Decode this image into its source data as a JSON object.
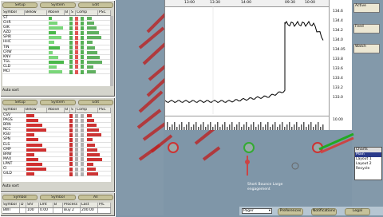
{
  "top_panel": {
    "buttons": [
      "Setup",
      "System",
      "Edit"
    ],
    "columns": [
      "Symbol",
      "Below",
      "Above",
      "B",
      "S",
      "Comp",
      "PSC"
    ],
    "symbols": [
      "ST",
      "CHR",
      "GIK",
      "AZD",
      "SPIR",
      "HHC",
      "TIN",
      "CRW",
      "KNV",
      "TGL",
      "CLD",
      "MCI"
    ],
    "status": "Auto sort"
  },
  "bottom_panel": {
    "buttons": [
      "Setup",
      "System",
      "Edit"
    ],
    "columns": [
      "Symbol",
      "Below",
      "Above",
      "B",
      "S",
      "Comp",
      "PSC"
    ],
    "symbols": [
      "CSV",
      "PAGS",
      "BRN",
      "NCC",
      "KSU",
      "SPN",
      "ELS",
      "CMP",
      "BRW",
      "MAX",
      "LPNT",
      "CI",
      "GILD"
    ],
    "status": "Auto sort"
  },
  "order_panel": {
    "buttons": [
      "Symbol",
      "Symbol",
      "All"
    ],
    "headers": [
      "Symbol",
      "D",
      "Shr",
      "Lmt",
      "B",
      "Process",
      "Last",
      "P/L"
    ],
    "row": [
      "BWT",
      "",
      "100",
      "0.00",
      "",
      "Buy 2",
      "200.00",
      ""
    ]
  },
  "chart": {
    "time_labels": [
      "13:00",
      "13:30",
      "14:00",
      "09:30",
      "10:00"
    ],
    "price_labels": [
      "134.6",
      "134.4",
      "134.2",
      "134.0",
      "134.05",
      "133.8",
      "133.6",
      "133.4",
      "133.2",
      "133.0"
    ],
    "volume_label": "10.00"
  },
  "right_sidebar": {
    "buttons": [
      "Active",
      "Feed",
      "Watch"
    ],
    "list_header": "Charts",
    "list_items": [
      "Main",
      "Layout 1",
      "Layout 2",
      "Recycle"
    ]
  },
  "annotations": {
    "label1": "Short Bounce  Large",
    "label2": "engagement"
  },
  "bottom_bar": {
    "select": "Pager",
    "buttons": [
      "Preferences",
      "Notifications",
      "Legal"
    ]
  }
}
